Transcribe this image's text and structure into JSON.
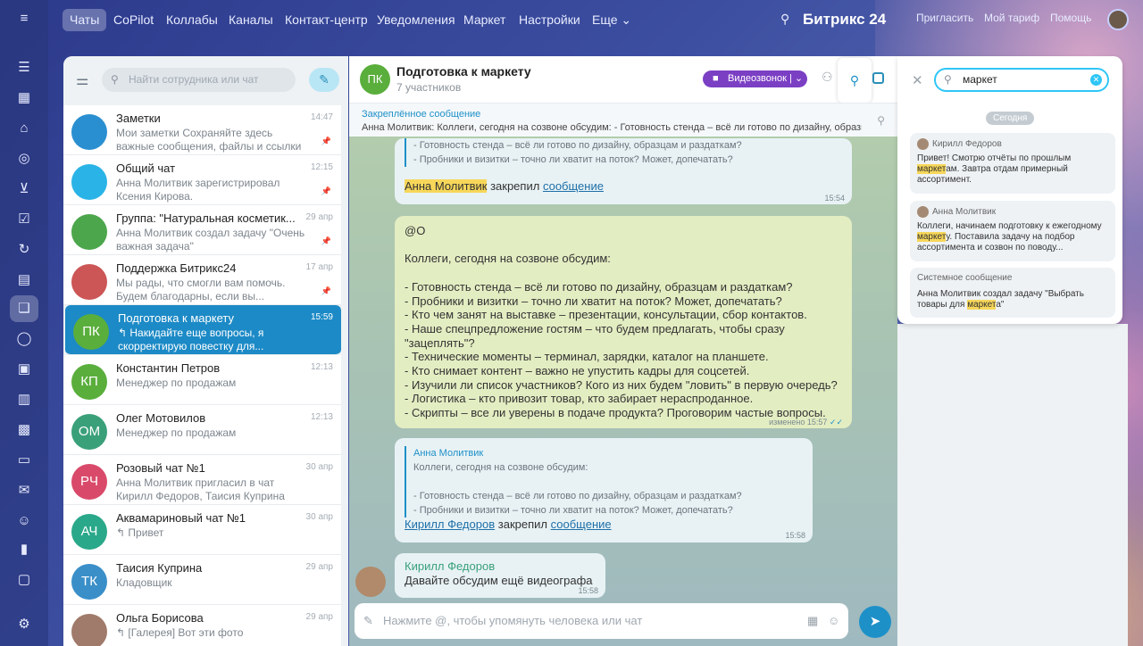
{
  "topbar": {
    "tabs": [
      "Чаты",
      "CoPilot",
      "Коллабы",
      "Каналы",
      "Контакт-центр",
      "Уведомления",
      "Маркет",
      "Настройки",
      "Еще"
    ],
    "brand": "Битрикс 24",
    "invite": "Пригласить",
    "tariff": "Мой тариф",
    "help": "Помощь"
  },
  "left": {
    "search_placeholder": "Найти сотрудника или чат",
    "chats": [
      {
        "initials": "",
        "name": "Заметки",
        "time": "14:47",
        "preview": "Мои заметки Сохраняйте здесь важные сообщения, файлы и ссылки",
        "color": "#2a8fd0"
      },
      {
        "initials": "",
        "name": "Общий чат",
        "time": "12:15",
        "preview": "Анна Молитвик зарегистрировал Ксения Кирова.",
        "color": "#2ab3e6"
      },
      {
        "initials": "",
        "name": "Группа: \"Натуральная косметик...",
        "time": "29 апр",
        "preview": "Анна Молитвик создал задачу \"Очень важная задача\"",
        "color": "#4ca64c"
      },
      {
        "initials": "",
        "name": "Поддержка Битрикс24",
        "time": "17 апр",
        "preview": "Мы рады, что смогли вам помочь. Будем благодарны, если вы...",
        "color": "#c55"
      },
      {
        "initials": "ПК",
        "name": "Подготовка к маркету",
        "time": "15:59",
        "preview": "↰ Накидайте еще вопросы, я скорректирую повестку для...",
        "color": "#5aae3c"
      },
      {
        "initials": "КП",
        "name": "Константин Петров",
        "time": "12:13",
        "preview": "Менеджер по продажам",
        "color": "#5aae3c"
      },
      {
        "initials": "ОМ",
        "name": "Олег Мотовилов",
        "time": "12:13",
        "preview": "Менеджер по продажам",
        "color": "#3aa07a"
      },
      {
        "initials": "РЧ",
        "name": "Розовый чат №1",
        "time": "30 апр",
        "preview": "Анна Молитвик пригласил в чат Кирилл Федоров, Таисия Куприна",
        "color": "#d94a6a"
      },
      {
        "initials": "АЧ",
        "name": "Аквамариновый чат №1",
        "time": "30 апр",
        "preview": "↰ Привет",
        "color": "#2aa88a"
      },
      {
        "initials": "ТК",
        "name": "Таисия Куприна",
        "time": "29 апр",
        "preview": "Кладовщик",
        "color": "#3a8fc8"
      },
      {
        "initials": "",
        "name": "Ольга Борисова",
        "time": "29 апр",
        "preview": "↰ [Галерея] Вот эти фото",
        "color": "#a07a6a"
      }
    ]
  },
  "chat": {
    "initials": "ПК",
    "title": "Подготовка к маркету",
    "subtitle": "7 участников",
    "video_label": "Видеозвонок",
    "pinned_label": "Закреплённое сообщение",
    "pinned_text": "Анна Молитвик: Коллеги, сегодня на созвоне обсудим: - Готовность стенда – всё ли готово по дизайну, образцам и раздаткам...",
    "msg1_q1": "- Готовность стенда – всё ли готово по дизайну, образцам и раздаткам?",
    "msg1_q2": "- Пробники и визитки – точно ли хватит на поток? Может, допечатать?",
    "msg1_name": "Анна Молитвик",
    "msg1_action": "закрепил",
    "msg1_link": "сообщение",
    "msg1_time": "15:54",
    "big_text": "@О\n\nКоллеги, сегодня на созвоне обсудим:\n\n- Готовность стенда – всё ли готово по дизайну, образцам и раздаткам?\n- Пробники и визитки – точно ли хватит на поток? Может, допечатать?\n- Кто чем занят на выставке – презентации, консультации, сбор контактов.\n- Наше спецпредложение гостям – что будем предлагать, чтобы сразу\n\"зацеплять\"?\n- Технические моменты – терминал, зарядки, каталог на планшете.\n- Кто снимает контент – важно не упустить кадры для соцсетей.\n- Изучили ли список участников? Кого из них будем \"ловить\" в первую очередь?\n- Логистика – кто привозит товар, кто забирает нераспроданное.\n- Скрипты – все ли уверены в подаче продукта? Проговорим частые вопросы.",
    "big_time": "изменено 15:57",
    "msg3_qname": "Анна Молитвик",
    "msg3_q0": "Коллеги, сегодня на созвоне обсудим:",
    "msg3_q1": "- Готовность стенда – всё ли готово по дизайну, образцам и раздаткам?",
    "msg3_q2": "- Пробники и визитки – точно ли хватит на поток? Может, допечатать?",
    "msg3_name": "Кирилл Федоров",
    "msg3_action": "закрепил",
    "msg3_link": "сообщение",
    "msg3_time": "15:58",
    "msg4_name": "Кирилл Федоров",
    "msg4_text": "Давайте обсудим ещё видеографа",
    "msg4_time": "15:58",
    "input_placeholder": "Нажмите @, чтобы упомянуть человека или чат"
  },
  "search_panel": {
    "query": "маркет",
    "date": "Сегодня",
    "results": [
      {
        "author": "Кирилл Федоров",
        "pre": "Привет! Смотрю отчёты по прошлым ",
        "hl": "маркет",
        "post": "ам. Завтра отдам примерный ассортимент."
      },
      {
        "author": "Анна Молитвик",
        "pre": "Коллеги, начинаем подготовку к ежегодному ",
        "hl": "маркет",
        "post": "у. Поставила задачу на подбор ассортимента и созвон по поводу..."
      },
      {
        "author": "Системное сообщение",
        "pre": "Анна Молитвик создал задачу \"Выбрать товары для ",
        "hl": "маркет",
        "post": "а\""
      }
    ]
  }
}
